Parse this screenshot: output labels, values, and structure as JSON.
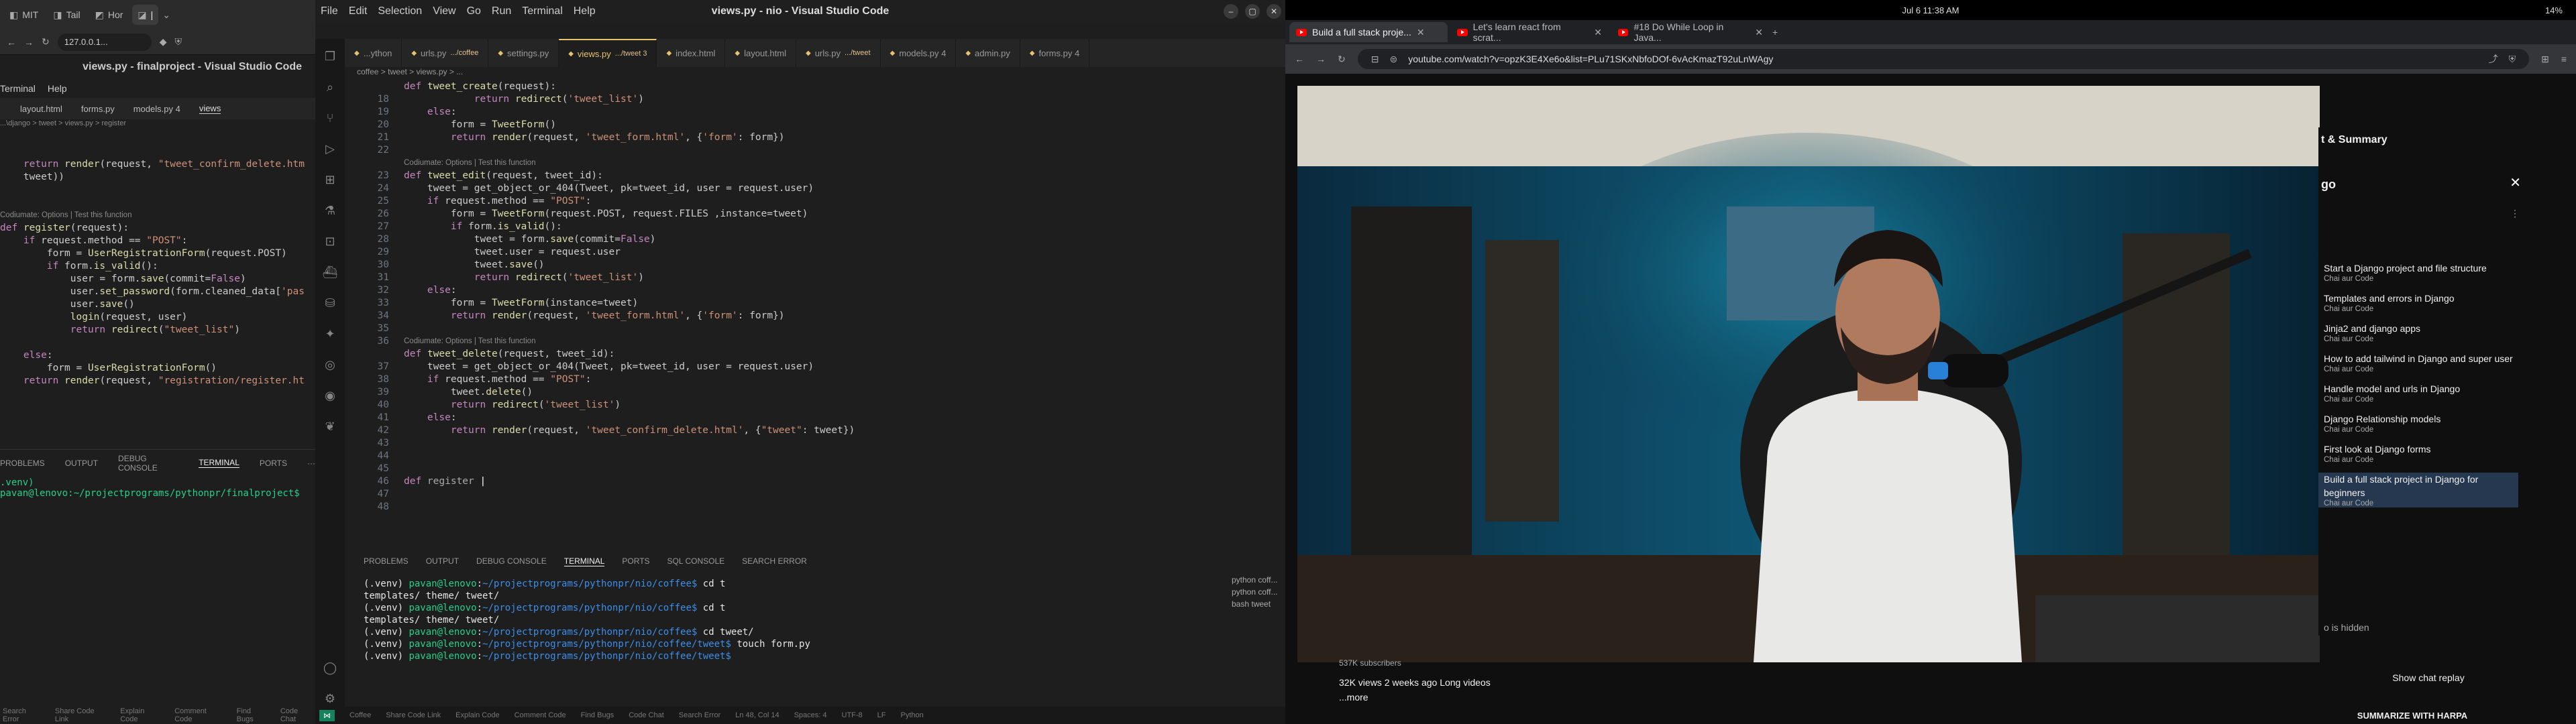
{
  "left": {
    "tabs": [
      "MIT",
      "Tail",
      "Hor",
      "|"
    ],
    "address": "127.0.0.1...",
    "window_title": "views.py - finalproject - Visual Studio Code",
    "menu": [
      "Terminal",
      "Help"
    ],
    "files": [
      "layout.html",
      "forms.py",
      "models.py 4",
      "views"
    ],
    "breadcrumb": "...\\django > tweet > views.py > register",
    "code": [
      {
        "t": "    return render(request, \"tweet_confirm_delete.htm",
        "cls": "code"
      },
      {
        "t": "    tweet))",
        "cls": "code"
      },
      {
        "t": "",
        "cls": "code"
      },
      {
        "t": "",
        "cls": "code"
      },
      {
        "t": "Codiumate: Options | Test this function",
        "cls": "lens"
      },
      {
        "t": "def register(request):",
        "cls": "code"
      },
      {
        "t": "    if request.method == \"POST\":",
        "cls": "code"
      },
      {
        "t": "        form = UserRegistrationForm(request.POST)",
        "cls": "code"
      },
      {
        "t": "        if form.is_valid():",
        "cls": "code"
      },
      {
        "t": "            user = form.save(commit=False)",
        "cls": "code"
      },
      {
        "t": "            user.set_password(form.cleaned_data['pas",
        "cls": "code"
      },
      {
        "t": "            user.save()",
        "cls": "code"
      },
      {
        "t": "            login(request, user)",
        "cls": "code"
      },
      {
        "t": "            return redirect(\"tweet_list\")",
        "cls": "code"
      },
      {
        "t": "",
        "cls": "code"
      },
      {
        "t": "    else:",
        "cls": "code"
      },
      {
        "t": "        form = UserRegistrationForm()",
        "cls": "code"
      },
      {
        "t": "    return render(request, \"registration/register.ht",
        "cls": "code"
      }
    ],
    "panel_tabs": [
      "PROBLEMS",
      "OUTPUT",
      "DEBUG CONSOLE",
      "TERMINAL",
      "PORTS",
      "···"
    ],
    "terminal": ".venv) pavan@lenovo:~/projectprograms/pythonpr/finalproject$",
    "status": [
      "Search Error",
      "Share Code Link",
      "Explain Code",
      "Comment Code",
      "Find Bugs",
      "Code Chat"
    ]
  },
  "center": {
    "menu": [
      "File",
      "Edit",
      "Selection",
      "View",
      "Go",
      "Run",
      "Terminal",
      "Help"
    ],
    "window_title": "views.py - nio - Visual Studio Code",
    "tabs": [
      {
        "label": "...ython",
        "mod": ""
      },
      {
        "label": "urls.py",
        "mod": ".../coffee"
      },
      {
        "label": "settings.py",
        "mod": ""
      },
      {
        "label": "views.py",
        "mod": ".../tweet 3"
      },
      {
        "label": "index.html",
        "mod": ""
      },
      {
        "label": "layout.html",
        "mod": ""
      },
      {
        "label": "urls.py",
        "mod": ".../tweet"
      },
      {
        "label": "models.py 4",
        "mod": ""
      },
      {
        "label": "admin.py",
        "mod": ""
      },
      {
        "label": "forms.py 4",
        "mod": ""
      }
    ],
    "breadcrumb": "coffee > tweet > views.py > ...",
    "line_numbers": [
      "",
      "18",
      "19",
      "20",
      "21",
      "22",
      "",
      "23",
      "24",
      "25",
      "26",
      "27",
      "28",
      "29",
      "30",
      "31",
      "32",
      "33",
      "34",
      "35",
      "36",
      "",
      "37",
      "38",
      "39",
      "40",
      "41",
      "42",
      "43",
      "44",
      "45",
      "46",
      "47",
      "48"
    ],
    "code": [
      {
        "t": "def tweet_create(request):",
        "cls": "code"
      },
      {
        "t": "            return redirect('tweet_list')",
        "cls": "code"
      },
      {
        "t": "    else:",
        "cls": "code"
      },
      {
        "t": "        form = TweetForm()",
        "cls": "code"
      },
      {
        "t": "        return render(request, 'tweet_form.html', {'form': form})",
        "cls": "code"
      },
      {
        "t": "",
        "cls": "code"
      },
      {
        "t": "Codiumate: Options | Test this function",
        "cls": "lens"
      },
      {
        "t": "def tweet_edit(request, tweet_id):",
        "cls": "code"
      },
      {
        "t": "    tweet = get_object_or_404(Tweet, pk=tweet_id, user = request.user)",
        "cls": "code"
      },
      {
        "t": "    if request.method == \"POST\":",
        "cls": "code"
      },
      {
        "t": "        form = TweetForm(request.POST, request.FILES ,instance=tweet)",
        "cls": "code"
      },
      {
        "t": "        if form.is_valid():",
        "cls": "code"
      },
      {
        "t": "            tweet = form.save(commit=False)",
        "cls": "code"
      },
      {
        "t": "            tweet.user = request.user",
        "cls": "code"
      },
      {
        "t": "            tweet.save()",
        "cls": "code"
      },
      {
        "t": "            return redirect('tweet_list')",
        "cls": "code"
      },
      {
        "t": "    else:",
        "cls": "code"
      },
      {
        "t": "        form = TweetForm(instance=tweet)",
        "cls": "code"
      },
      {
        "t": "        return render(request, 'tweet_form.html', {'form': form})",
        "cls": "code"
      },
      {
        "t": "",
        "cls": "code"
      },
      {
        "t": "Codiumate: Options | Test this function",
        "cls": "lens"
      },
      {
        "t": "def tweet_delete(request, tweet_id):",
        "cls": "code"
      },
      {
        "t": "    tweet = get_object_or_404(Tweet, pk=tweet_id, user = request.user)",
        "cls": "code"
      },
      {
        "t": "    if request.method == \"POST\":",
        "cls": "code"
      },
      {
        "t": "        tweet.delete()",
        "cls": "code"
      },
      {
        "t": "        return redirect('tweet_list')",
        "cls": "code"
      },
      {
        "t": "    else:",
        "cls": "code"
      },
      {
        "t": "        return render(request, 'tweet_confirm_delete.html', {\"tweet\": tweet})",
        "cls": "code"
      },
      {
        "t": "",
        "cls": "code"
      },
      {
        "t": "",
        "cls": "code"
      },
      {
        "t": "",
        "cls": "code"
      },
      {
        "t": "def register ",
        "cls": "code cur"
      }
    ],
    "panel_tabs": [
      "PROBLEMS",
      "OUTPUT",
      "DEBUG CONSOLE",
      "TERMINAL",
      "PORTS",
      "SQL CONSOLE",
      "SEARCH ERROR"
    ],
    "terminal": [
      "(.venv) pavan@lenovo:~/projectprograms/pythonpr/nio/coffee$ cd t",
      "templates/ theme/       tweet/",
      "(.venv) pavan@lenovo:~/projectprograms/pythonpr/nio/coffee$ cd t",
      "templates/ theme/       tweet/",
      "(.venv) pavan@lenovo:~/projectprograms/pythonpr/nio/coffee$ cd tweet/",
      "(.venv) pavan@lenovo:~/projectprograms/pythonpr/nio/coffee/tweet$ touch form.py",
      "(.venv) pavan@lenovo:~/projectprograms/pythonpr/nio/coffee/tweet$ "
    ],
    "terminal_list": [
      "python coff...",
      "python coff...",
      "bash tweet"
    ],
    "status": [
      "Coffee",
      "Share Code Link",
      "Explain Code",
      "Comment Code",
      "Find Bugs",
      "Code Chat",
      "Search Error",
      "Ln 48, Col 14",
      "Spaces: 4",
      "UTF-8",
      "LF",
      "Python"
    ]
  },
  "right": {
    "top_left": "Jul 6  11:38 AM",
    "battery": "14%",
    "tabs": [
      "Build a full stack proje...",
      "Let's learn react from scrat...",
      "#18 Do While Loop in Java..."
    ],
    "url": "youtube.com/watch?v=opzK3E4Xe6o&list=PLu71SKxNbfoDOf-6vAcKmazT92uLnWAgy",
    "panel_title": "t & Summary",
    "panel_sub": "go",
    "chapters": [
      {
        "t": "Start a Django project and file structure",
        "s": "Chai aur Code"
      },
      {
        "t": "Templates and errors in Django",
        "s": "Chai aur Code"
      },
      {
        "t": "Jinja2 and django apps",
        "s": "Chai aur Code"
      },
      {
        "t": "How to add tailwind in Django and super user",
        "s": "Chai aur Code"
      },
      {
        "t": "Handle model and urls in Django",
        "s": "Chai aur Code"
      },
      {
        "t": "Django Relationship models",
        "s": "Chai aur Code"
      },
      {
        "t": "First look at Django forms",
        "s": "Chai aur Code"
      },
      {
        "t": "Build a full stack project in Django for beginners",
        "s": "Chai aur Code"
      }
    ],
    "hidden_note": "o is hidden",
    "subscribers": "537K subscribers",
    "views": "32K views  2 weeks ago  Long videos",
    "more": "...more",
    "show_chat": "Show chat replay",
    "harpa": "SUMMARIZE WITH HARPA"
  }
}
